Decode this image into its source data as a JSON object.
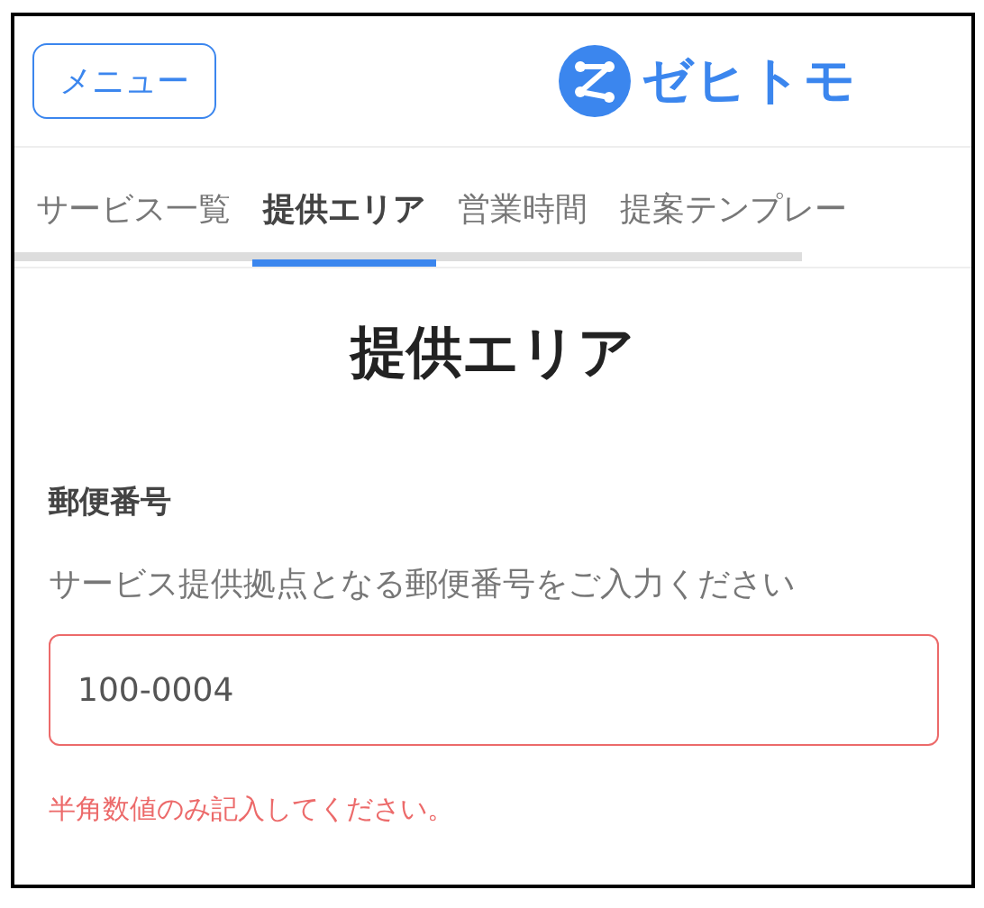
{
  "header": {
    "menu_button": "メニュー",
    "logo_text": "ゼヒトモ"
  },
  "tabs": [
    {
      "label": "サービス一覧",
      "selected": false
    },
    {
      "label": "提供エリア",
      "selected": true
    },
    {
      "label": "営業時間",
      "selected": false
    },
    {
      "label": "提案テンプレー",
      "selected": false
    }
  ],
  "page_title": "提供エリア",
  "field": {
    "label": "郵便番号",
    "hint": "サービス提供拠点となる郵便番号をご入力ください",
    "value": "100-0004",
    "error": true,
    "error_message": "半角数値のみ記入してください。"
  }
}
